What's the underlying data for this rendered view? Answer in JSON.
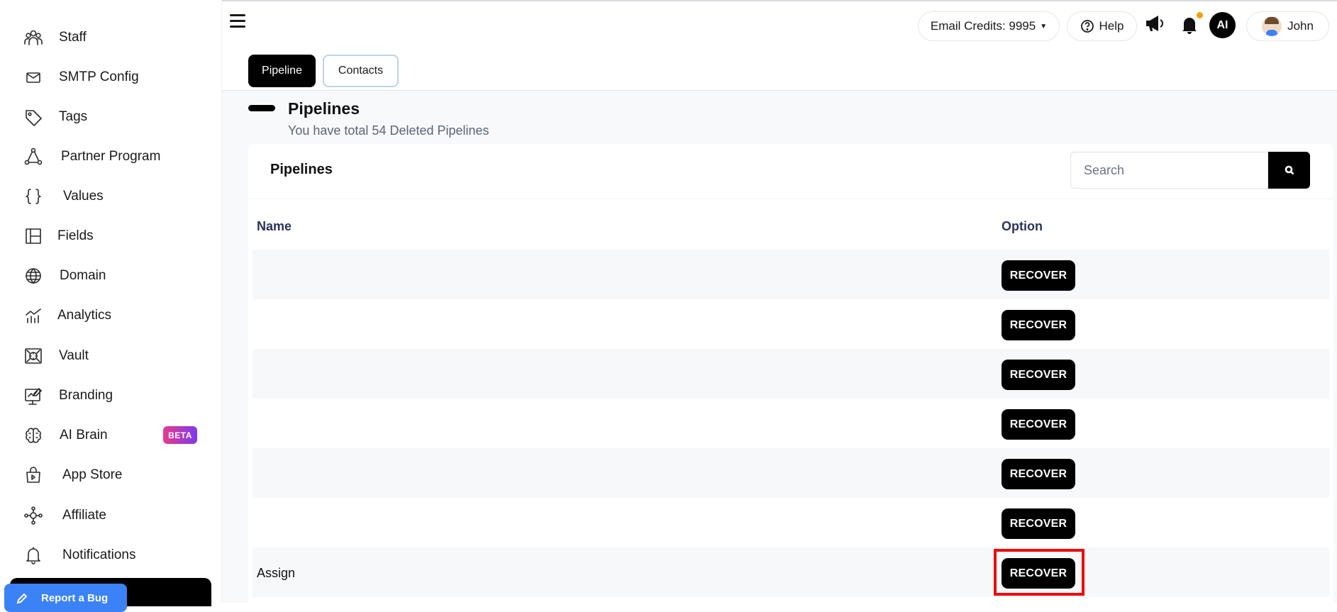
{
  "sidebar": {
    "items": [
      {
        "label": "Staff",
        "icon": "staff-icon"
      },
      {
        "label": "SMTP Config",
        "icon": "mail-icon"
      },
      {
        "label": "Tags",
        "icon": "tag-icon"
      },
      {
        "label": "Partner Program",
        "icon": "partner-icon"
      },
      {
        "label": "Values",
        "icon": "braces-icon"
      },
      {
        "label": "Fields",
        "icon": "fields-icon"
      },
      {
        "label": "Domain",
        "icon": "globe-icon"
      },
      {
        "label": "Analytics",
        "icon": "analytics-icon"
      },
      {
        "label": "Vault",
        "icon": "vault-icon"
      },
      {
        "label": "Branding",
        "icon": "branding-icon"
      },
      {
        "label": "AI Brain",
        "icon": "brain-icon",
        "badge": "BETA"
      },
      {
        "label": "App Store",
        "icon": "store-icon"
      },
      {
        "label": "Affiliate",
        "icon": "affiliate-icon"
      },
      {
        "label": "Notifications",
        "icon": "bell-icon"
      }
    ],
    "report_bug_label": "Report a Bug"
  },
  "header": {
    "email_credits": "Email Credits: 9995",
    "help_label": "Help",
    "ai_avatar": "AI",
    "user_name": "John"
  },
  "tabs": [
    {
      "label": "Pipeline",
      "active": true
    },
    {
      "label": "Contacts",
      "active": false
    }
  ],
  "page": {
    "title": "Pipelines",
    "subtitle": "You have total 54 Deleted Pipelines"
  },
  "card": {
    "title": "Pipelines",
    "search_placeholder": "Search"
  },
  "table": {
    "columns": [
      "Name",
      "Option"
    ],
    "rows": [
      {
        "name": "",
        "action": "RECOVER"
      },
      {
        "name": "",
        "action": "RECOVER"
      },
      {
        "name": "",
        "action": "RECOVER"
      },
      {
        "name": "",
        "action": "RECOVER"
      },
      {
        "name": "",
        "action": "RECOVER"
      },
      {
        "name": "",
        "action": "RECOVER"
      },
      {
        "name": "Assign",
        "action": "RECOVER"
      }
    ]
  },
  "colors": {
    "accent": "#000000",
    "highlight": "#ee0a0a",
    "beta_gradient_start": "#e83a8b",
    "beta_gradient_end": "#7c3aed",
    "report_bug": "#3b82f6"
  }
}
